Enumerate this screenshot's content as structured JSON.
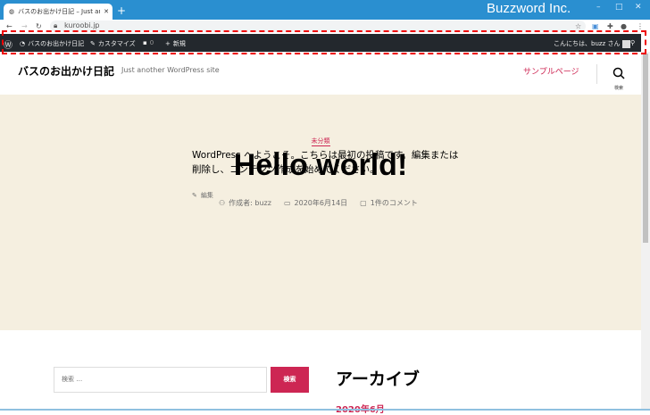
{
  "browser": {
    "tab_title": "バスのお出かけ日記 – Just another",
    "url": "kuroobi.jp",
    "brand": "Buzzword Inc."
  },
  "admin_bar": {
    "site": "バスのお出かけ日記",
    "customize": "カスタマイズ",
    "comments_count": "0",
    "new": "新規",
    "greeting": "こんにちは、buzz さん"
  },
  "header": {
    "site_title": "バスのお出かけ日記",
    "tagline": "Just another WordPress site",
    "nav": [
      "サンプルページ"
    ],
    "search_label": "検索"
  },
  "post": {
    "category": "未分類",
    "title": "Hello world!",
    "author": "作成者: buzz",
    "date": "2020年6月14日",
    "comments": "1件のコメント",
    "content": "WordPress へようこそ。こちらは最初の投稿です。編集または削除し、コンテンツ作成を始めてください。",
    "edit": "編集"
  },
  "widgets": {
    "search_placeholder": "検索 …",
    "search_button": "検索",
    "archive_title": "アーカイブ",
    "archive_items": [
      "2020年6月"
    ]
  },
  "colors": {
    "accent": "#cd2653",
    "hero_bg": "#f5efe0",
    "admin_bg": "#23282d",
    "titlebar": "#2a8fd0"
  }
}
